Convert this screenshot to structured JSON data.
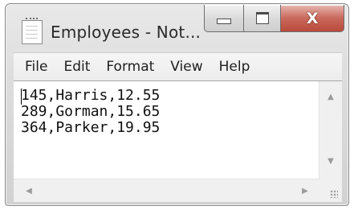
{
  "window": {
    "title": "Employees - Not...",
    "icon": "notepad-icon",
    "controls": {
      "minimize": "minimize-icon",
      "maximize": "maximize-icon",
      "close_label": "X"
    }
  },
  "menu": {
    "items": [
      "File",
      "Edit",
      "Format",
      "View",
      "Help"
    ]
  },
  "document": {
    "lines": [
      "145,Harris,12.55",
      "289,Gorman,15.65",
      "364,Parker,19.95"
    ]
  },
  "scrollbars": {
    "up": "▲",
    "down": "▼",
    "left": "◀",
    "right": "▶"
  }
}
